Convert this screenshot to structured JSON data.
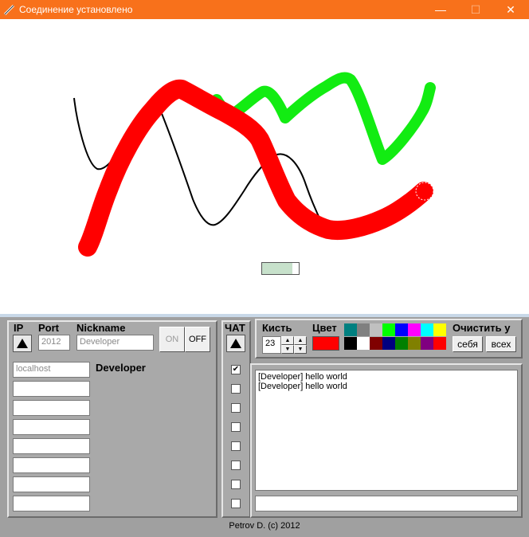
{
  "window": {
    "title": "Соединение установлено",
    "controls": [
      "—",
      "☐",
      "✕"
    ]
  },
  "brush_indicator": {
    "fill_fraction": 0.82,
    "color": "#c7e1cb"
  },
  "connection": {
    "ip_label": "IP",
    "port_label": "Port",
    "nickname_label": "Nickname",
    "port_value": "2012",
    "nickname_value": "Developer",
    "on_label": "ON",
    "off_label": "OFF"
  },
  "users": {
    "current_nickname": "Developer",
    "ip_list": [
      "localhost",
      "",
      "",
      "",
      "",
      "",
      "",
      ""
    ],
    "checks": [
      true,
      false,
      false,
      false,
      false,
      false,
      false,
      false
    ]
  },
  "chat": {
    "chat_label": "ЧАТ",
    "messages": [
      "[Developer] hello world",
      "[Developer] hello world"
    ],
    "input_value": ""
  },
  "brush": {
    "brush_label": "Кисть",
    "size_value": "23",
    "color_label": "Цвет",
    "current_color": "#ff0000",
    "clear_label": "Очистить у",
    "clear_self_label": "себя",
    "clear_all_label": "всех",
    "palette": [
      "#008080",
      "#808080",
      "#c0c0c0",
      "#00ff00",
      "#0000ff",
      "#ff00ff",
      "#00ffff",
      "#ffff00",
      "#000000",
      "#ffffff",
      "#800000",
      "#000080",
      "#008000",
      "#808000",
      "#800080",
      "#ff0000"
    ]
  },
  "footer": {
    "text": "Petrov D. (c) 2012"
  }
}
